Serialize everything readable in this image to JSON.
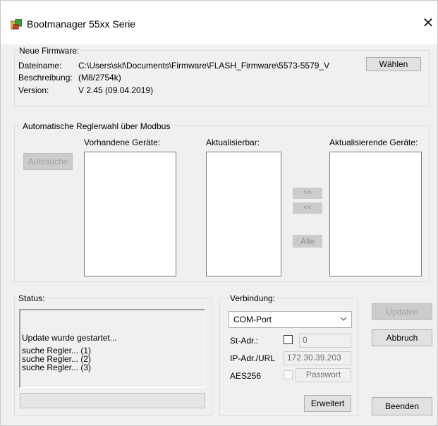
{
  "window": {
    "title": "Bootmanager 55xx Serie",
    "close_glyph": "✕"
  },
  "firmware": {
    "caption": "Neue Firmware:",
    "filename_label": "Dateiname:",
    "filename_value": "C:\\Users\\skl\\Documents\\Firmware\\FLASH_Firmware\\5573-5579_V",
    "choose_button": "Wählen",
    "description_label": "Beschreibung:",
    "description_value": "(M8/2754k)",
    "version_label": "Version:",
    "version_value": "V 2.45 (09.04.2019)"
  },
  "modbus": {
    "caption": "Automatische Reglerwahl über Modbus",
    "autosearch_button": "Autosuche",
    "available_label": "Vorhandene Geräte:",
    "updatable_label": "Aktualisierbar:",
    "updating_label": "Aktualisierende Geräte:",
    "move_right_button": ">>",
    "move_left_button": "<<",
    "all_button": "Alle"
  },
  "status": {
    "caption": "Status:",
    "lines": [
      "Update wurde gestartet...",
      "suche Regler... (1)",
      "suche Regler... (2)",
      "suche Regler... (3)"
    ],
    "progress": 0
  },
  "connection": {
    "caption": "Verbindung:",
    "port_selected": "COM-Port",
    "station_label": "St-Adr.:",
    "station_value": "0",
    "ip_label": "IP-Adr./URL",
    "ip_value": "172.30.39.203",
    "aes_label": "AES256",
    "password_placeholder": "Passwort",
    "advanced_button": "Erweitert"
  },
  "actions": {
    "update_button": "Updaten",
    "abort_button": "Abbruch",
    "exit_button": "Beenden"
  },
  "colors": {
    "window_bg": "#f0f0f0",
    "disabled_text": "#a0a0a0"
  }
}
